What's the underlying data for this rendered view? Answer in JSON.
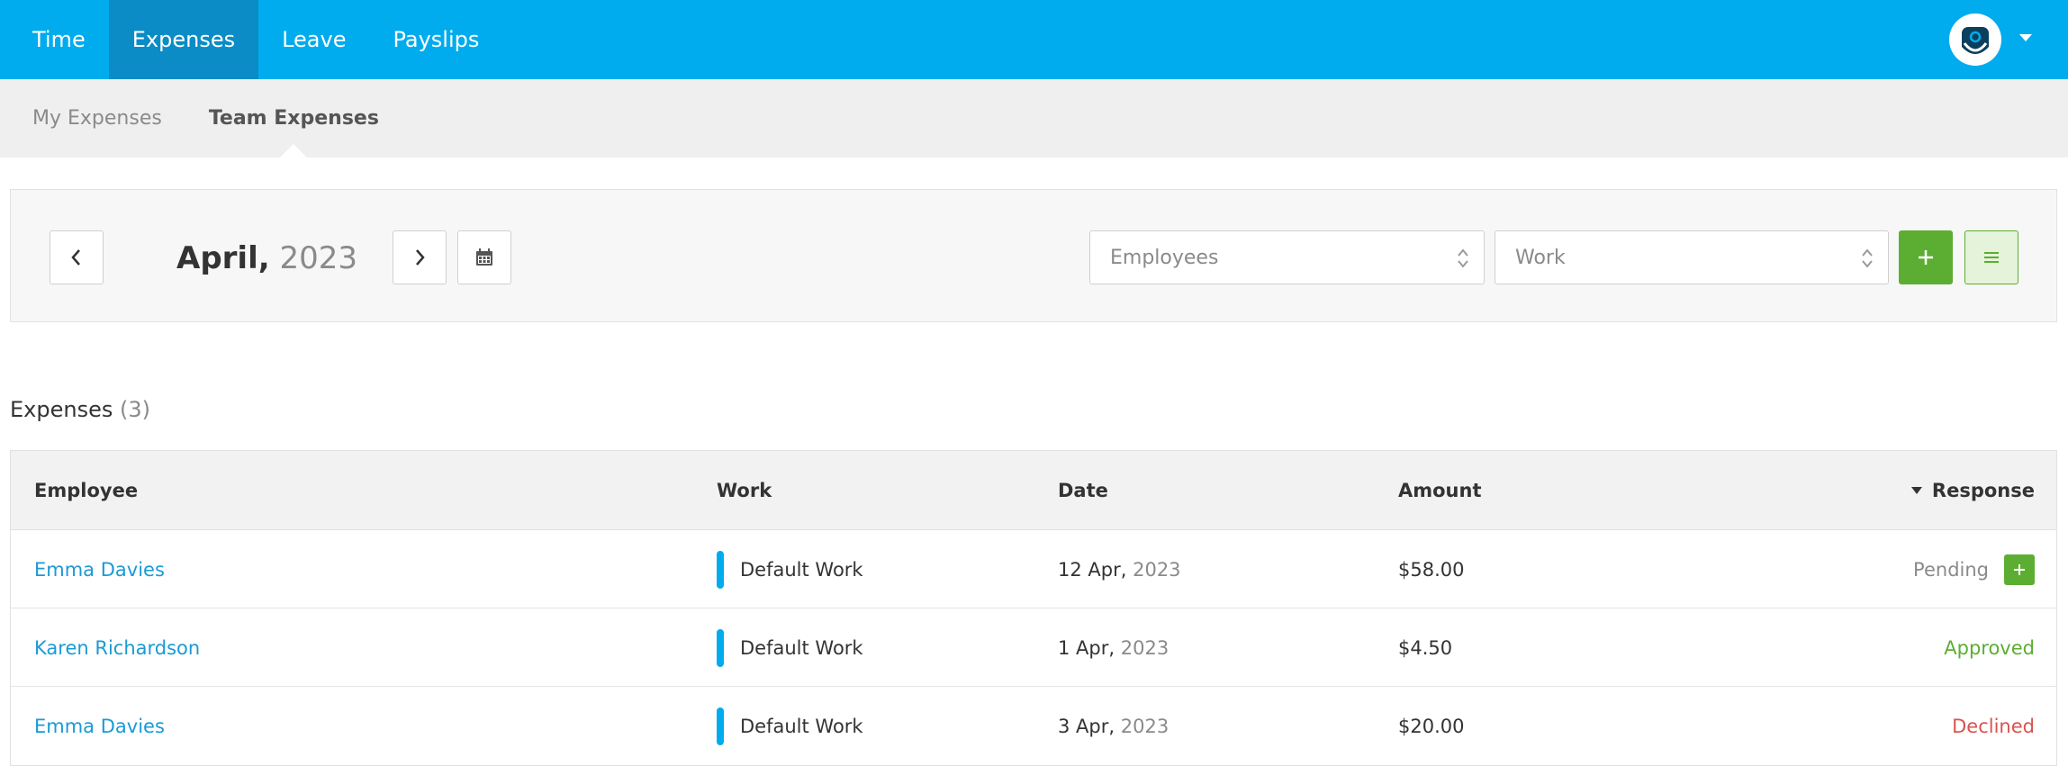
{
  "top_nav": {
    "items": [
      {
        "label": "Time",
        "active": false
      },
      {
        "label": "Expenses",
        "active": true
      },
      {
        "label": "Leave",
        "active": false
      },
      {
        "label": "Payslips",
        "active": false
      }
    ],
    "avatar_icon": "user-avatar-icon"
  },
  "sub_nav": {
    "items": [
      {
        "label": "My Expenses",
        "active": false
      },
      {
        "label": "Team Expenses",
        "active": true
      }
    ]
  },
  "toolbar": {
    "month": "April,",
    "year": "2023",
    "employees_placeholder": "Employees",
    "work_placeholder": "Work",
    "icons": {
      "prev": "chevron-left-icon",
      "next": "chevron-right-icon",
      "calendar": "calendar-icon",
      "add": "plus-icon",
      "list": "list-icon"
    }
  },
  "section": {
    "title": "Expenses",
    "count": "(3)"
  },
  "table": {
    "headers": {
      "employee": "Employee",
      "work": "Work",
      "date": "Date",
      "amount": "Amount",
      "response": "Response"
    },
    "rows": [
      {
        "employee": "Emma Davies",
        "work": "Default Work",
        "date_day": "12 Apr,",
        "date_year": "2023",
        "amount": "$58.00",
        "response": "Pending",
        "status": "pending"
      },
      {
        "employee": "Karen Richardson",
        "work": "Default Work",
        "date_day": "1 Apr,",
        "date_year": "2023",
        "amount": "$4.50",
        "response": "Approved",
        "status": "approved"
      },
      {
        "employee": "Emma Davies",
        "work": "Default Work",
        "date_day": "3 Apr,",
        "date_year": "2023",
        "amount": "$20.00",
        "response": "Declined",
        "status": "declined"
      }
    ]
  },
  "colors": {
    "brand": "#00aced",
    "brand_active": "#0b8cc6",
    "success": "#5cae32",
    "danger": "#d9534f",
    "link": "#1a9ad6"
  }
}
